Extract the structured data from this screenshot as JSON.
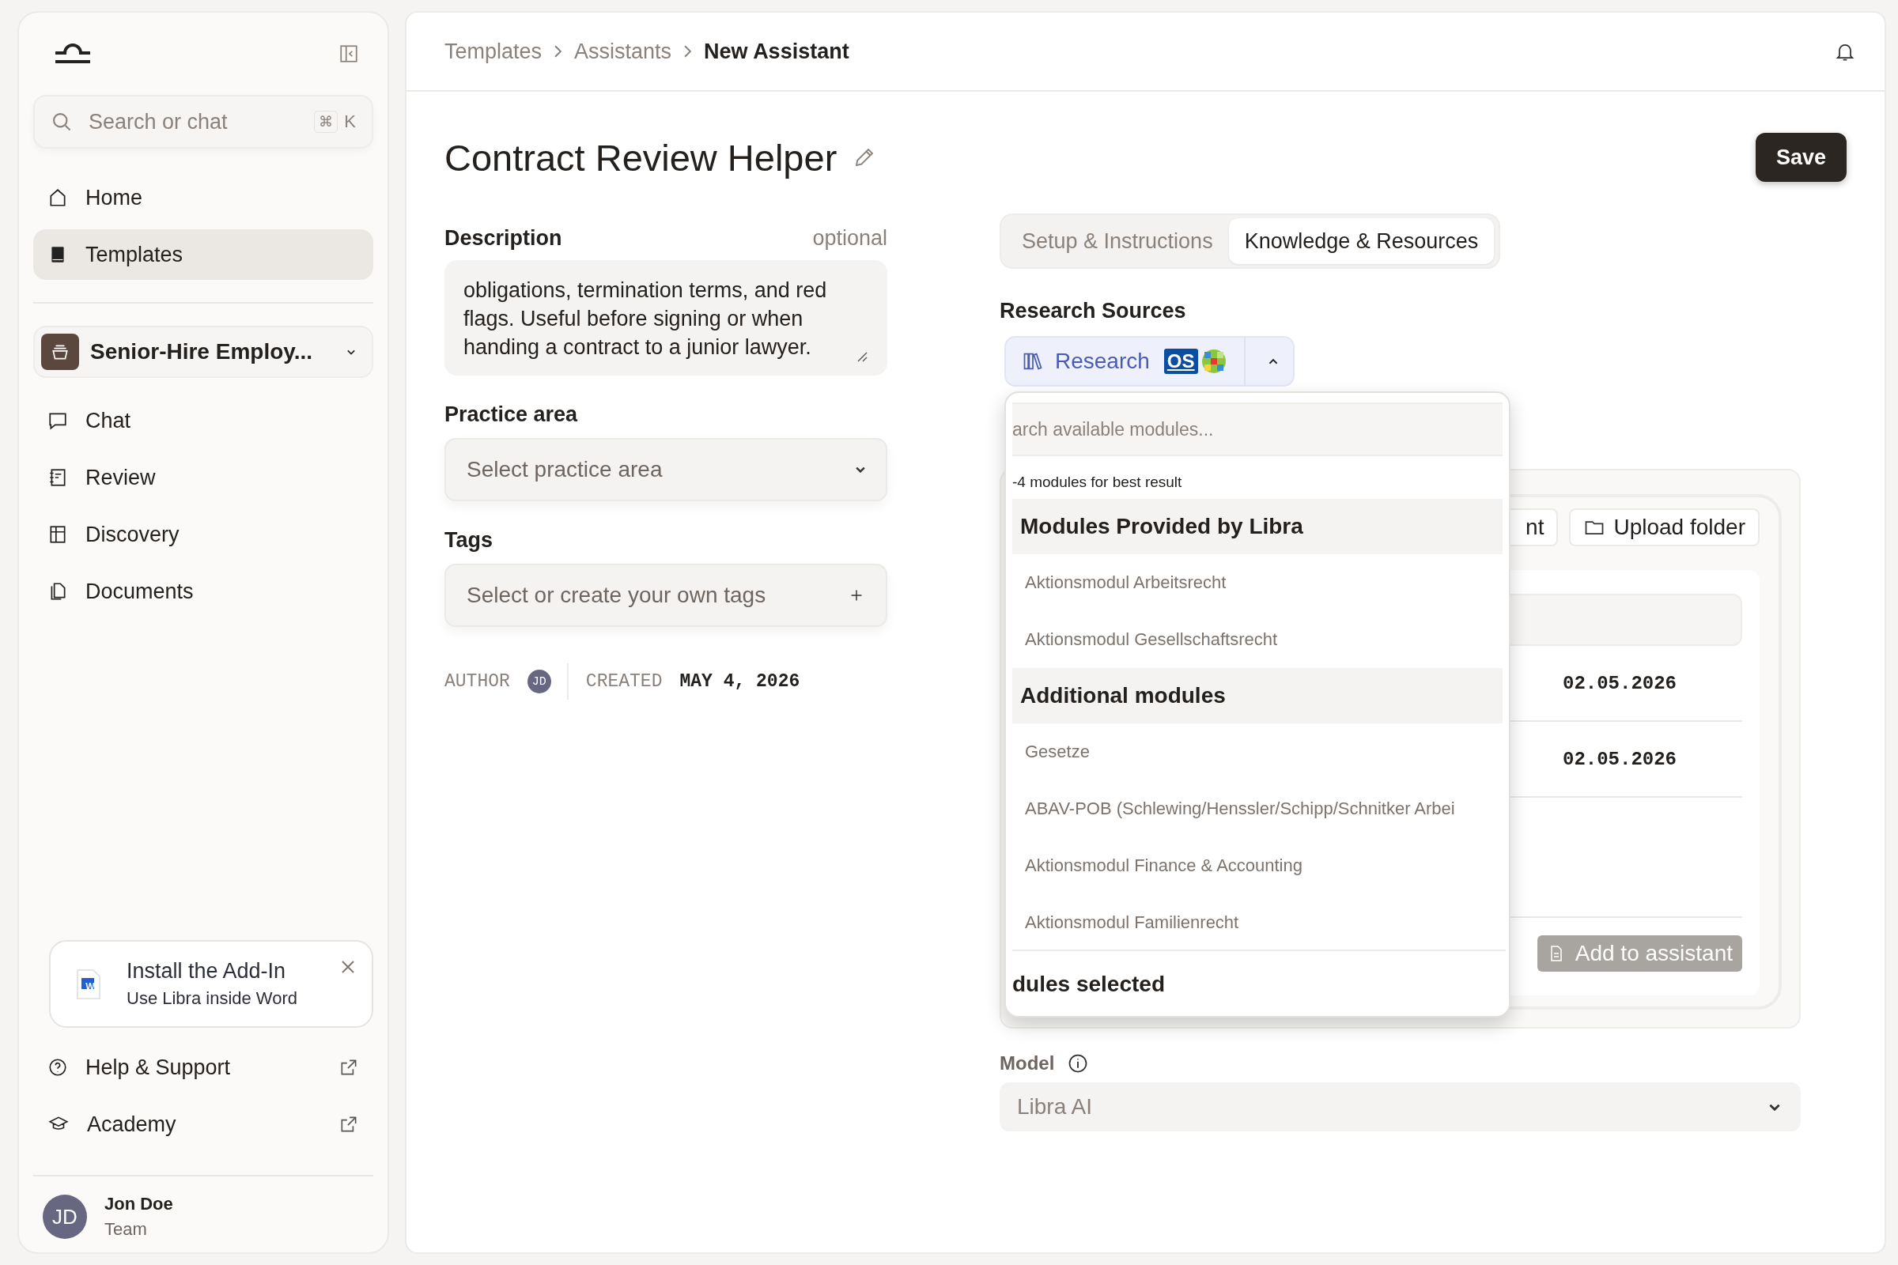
{
  "sidebar": {
    "search": {
      "placeholder": "Search or chat",
      "shortcut_key": "⌘",
      "shortcut_letter": "K"
    },
    "primary_nav": [
      {
        "label": "Home",
        "selected": false
      },
      {
        "label": "Templates",
        "selected": true
      }
    ],
    "workspace": {
      "name": "Senior-Hire Employ..."
    },
    "workspace_nav": [
      {
        "label": "Chat",
        "selected": false
      },
      {
        "label": "Review",
        "selected": false
      },
      {
        "label": "Discovery",
        "selected": false
      },
      {
        "label": "Documents",
        "selected": false
      }
    ],
    "addin": {
      "title": "Install the Add-In",
      "subtitle": "Use Libra inside Word",
      "badge": "W"
    },
    "links": [
      {
        "label": "Help & Support"
      },
      {
        "label": "Academy"
      }
    ],
    "user": {
      "initials": "JD",
      "name": "Jon Doe",
      "role": "Team"
    }
  },
  "breadcrumb": [
    {
      "label": "Templates",
      "current": false
    },
    {
      "label": "Assistants",
      "current": false
    },
    {
      "label": "New Assistant",
      "current": true
    }
  ],
  "title": "Contract Review Helper",
  "save_button": "Save",
  "form": {
    "description": {
      "label": "Description",
      "hint": "optional",
      "value": "obligations, termination terms, and red flags. Useful before signing or when handing a contract to a junior lawyer."
    },
    "practice_area": {
      "label": "Practice area",
      "placeholder": "Select practice area"
    },
    "tags": {
      "label": "Tags",
      "placeholder": "Select or create your own tags"
    },
    "meta": {
      "author_label": "AUTHOR",
      "author_initials": "JD",
      "created_label": "CREATED",
      "created_value": "MAY 4, 2026"
    }
  },
  "tabs": [
    {
      "label": "Setup & Instructions",
      "selected": false
    },
    {
      "label": "Knowledge & Resources",
      "selected": true
    }
  ],
  "research": {
    "label": "Research Sources",
    "button_label": "Research",
    "logo_text": "OS",
    "expanded": true
  },
  "dropdown": {
    "search_placeholder": "arch available modules...",
    "hint": "-4 modules for best result",
    "groups": [
      {
        "title": "Modules Provided by Libra",
        "items": [
          "Aktionsmodul Arbeitsrecht",
          "Aktionsmodul Gesellschaftsrecht"
        ]
      },
      {
        "title": "Additional modules",
        "items": [
          "Gesetze",
          "ABAV-POB (Schlewing/Henssler/Schipp/Schnitker Arbei",
          "Aktionsmodul Finance & Accounting",
          "Aktionsmodul Familienrecht"
        ]
      }
    ],
    "footer": "dules selected"
  },
  "knowledge": {
    "buttons": [
      "nt",
      "Upload folder"
    ],
    "rows": [
      {
        "date": "02.05.2026"
      },
      {
        "date": "02.05.2026"
      }
    ],
    "add_button": {
      "label": "Add to assistant",
      "disabled": true
    }
  },
  "model": {
    "label": "Model",
    "value": "Libra AI"
  }
}
